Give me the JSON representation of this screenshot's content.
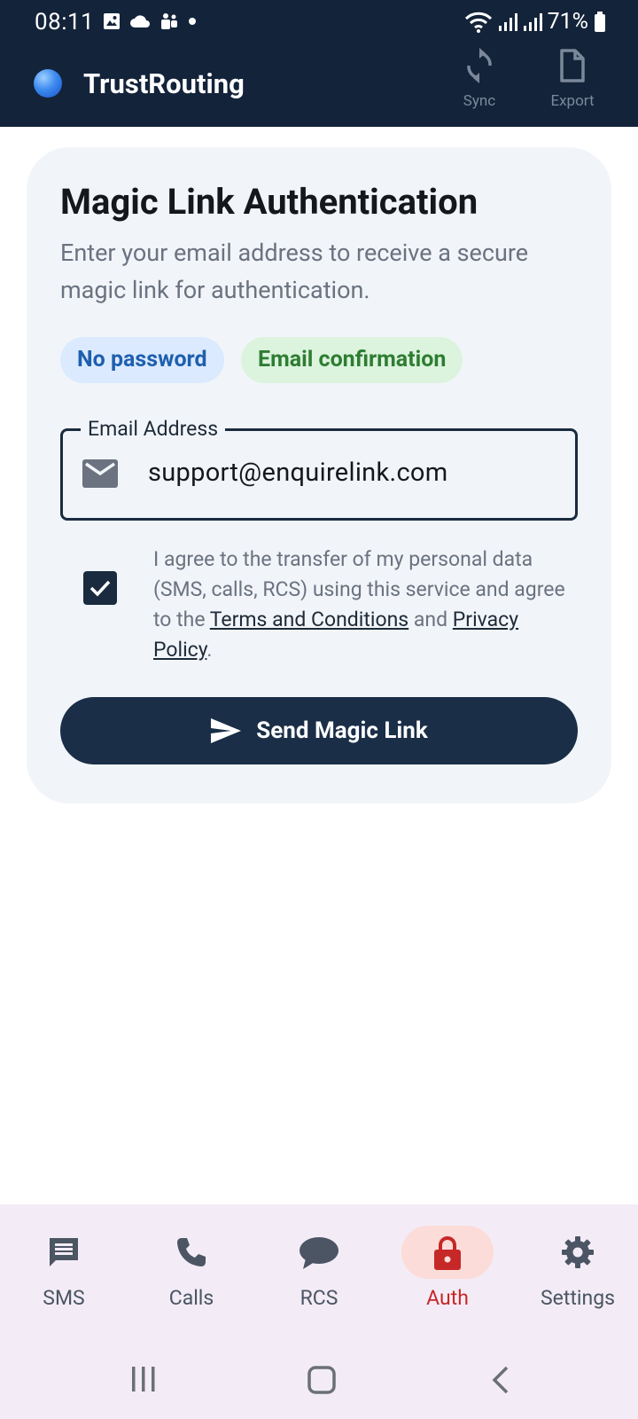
{
  "status_bar": {
    "time": "08:11",
    "battery": "71%"
  },
  "app_bar": {
    "title": "TrustRouting",
    "actions": [
      {
        "label": "Sync",
        "icon": "sync-icon"
      },
      {
        "label": "Export",
        "icon": "file-icon"
      }
    ]
  },
  "card": {
    "title": "Magic Link Authentication",
    "description": "Enter your email address to receive a secure magic link for authentication.",
    "chips": [
      "No password",
      "Email confirmation"
    ],
    "email_field": {
      "label": "Email Address",
      "value": "support@enquirelink.com"
    },
    "consent": {
      "checked": true,
      "text_before": "I agree to the transfer of my personal data (SMS, calls, RCS) using this service and agree to the ",
      "terms_link": "Terms and Conditions",
      "text_middle": " and ",
      "privacy_link": "Privacy Policy",
      "text_after": "."
    },
    "send_button": "Send Magic Link"
  },
  "bottom_nav": {
    "items": [
      {
        "label": "SMS",
        "icon": "message-icon",
        "active": false
      },
      {
        "label": "Calls",
        "icon": "phone-icon",
        "active": false
      },
      {
        "label": "RCS",
        "icon": "chat-bubble-icon",
        "active": false
      },
      {
        "label": "Auth",
        "icon": "lock-icon",
        "active": true
      },
      {
        "label": "Settings",
        "icon": "gear-icon",
        "active": false
      }
    ]
  },
  "colors": {
    "header_bg": "#13233a",
    "primary": "#1a2e47",
    "active_tab": "#c62828",
    "active_tab_pill": "#fcdcd8",
    "chip_blue_bg": "#dbeafe",
    "chip_green_bg": "#dcf3de"
  }
}
